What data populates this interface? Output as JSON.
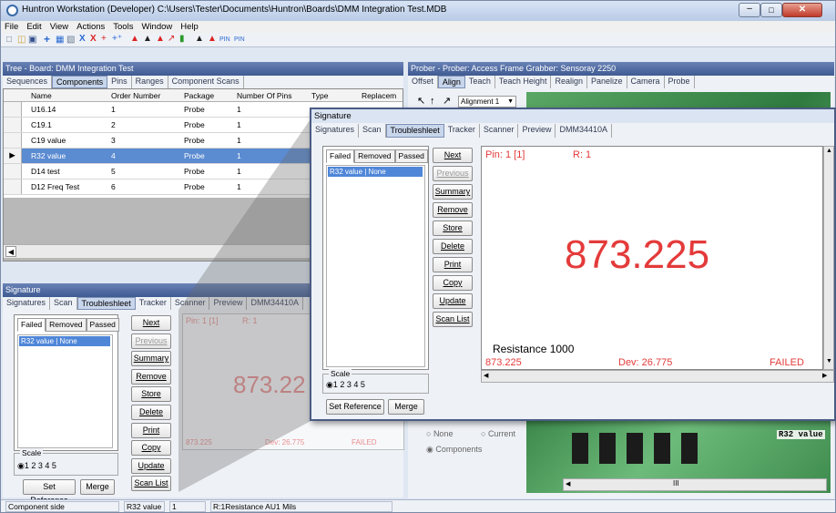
{
  "window": {
    "title": "Huntron Workstation (Developer) C:\\Users\\Tester\\Documents\\Huntron\\Boards\\DMM Integration Test.MDB",
    "menu": [
      "File",
      "Edit",
      "View",
      "Actions",
      "Tools",
      "Window",
      "Help"
    ]
  },
  "tree": {
    "title": "Tree - Board: DMM Integration Test",
    "tabs": [
      "Sequences",
      "Components",
      "Pins",
      "Ranges",
      "Component Scans"
    ],
    "active_tab": "Components",
    "columns": [
      "Name",
      "Order Number",
      "Package",
      "Number Of Pins",
      "Type",
      "Replacem"
    ],
    "rows": [
      {
        "name": "U16.14",
        "order": "1",
        "package": "Probe",
        "pins": "1"
      },
      {
        "name": "C19.1",
        "order": "2",
        "package": "Probe",
        "pins": "1"
      },
      {
        "name": "C19 value",
        "order": "3",
        "package": "Probe",
        "pins": "1"
      },
      {
        "name": "R32 value",
        "order": "4",
        "package": "Probe",
        "pins": "1"
      },
      {
        "name": "D14 test",
        "order": "5",
        "package": "Probe",
        "pins": "1"
      },
      {
        "name": "D12 Freq Test",
        "order": "6",
        "package": "Probe",
        "pins": "1"
      }
    ],
    "selected_row": 3
  },
  "prober": {
    "title": "Prober - Prober: Access Frame Grabber: Sensoray 2250",
    "tabs": [
      "Offset",
      "Align",
      "Teach",
      "Teach Height",
      "Realign",
      "Panelize",
      "Camera",
      "Probe"
    ],
    "active_tab": "Align",
    "alignment_value": "Alignment 1",
    "radio_none": "None",
    "radio_current": "Current",
    "radio_components": "Components",
    "board_label": "R32 value",
    "scroll_mark": "III"
  },
  "signature_small": {
    "title": "Signature",
    "tabs": [
      "Signatures",
      "Scan",
      "Troubleshleet",
      "Tracker",
      "Scanner",
      "Preview",
      "DMM34410A"
    ],
    "active_tab": "Troubleshleet",
    "list_tabs": [
      "Failed",
      "Removed",
      "Passed"
    ],
    "list_items": [
      "R32 value | None"
    ],
    "buttons": [
      "Next",
      "Previous",
      "Summary",
      "Remove",
      "Store",
      "Delete",
      "Print",
      "Copy",
      "Update",
      "Scan List"
    ],
    "scale_label": "Scale",
    "scale_options": "1  2  3  4  5",
    "set_reference": "Set Reference",
    "merge": "Merge",
    "pin_label": "Pin: 1 [1]",
    "r_label": "R: 1",
    "reading": "873.22",
    "footer_value": "873.225",
    "footer_dev": "Dev: 26.775",
    "footer_status": "FAILED"
  },
  "signature_large": {
    "title": "Signature",
    "tabs": [
      "Signatures",
      "Scan",
      "Troubleshleet",
      "Tracker",
      "Scanner",
      "Preview",
      "DMM34410A"
    ],
    "active_tab": "Troubleshleet",
    "list_tabs": [
      "Failed",
      "Removed",
      "Passed"
    ],
    "list_items": [
      "R32 value | None"
    ],
    "buttons": [
      "Next",
      "Previous",
      "Summary",
      "Remove",
      "Store",
      "Delete",
      "Print",
      "Copy",
      "Update",
      "Scan List"
    ],
    "scale_label": "Scale",
    "scale_options": "1  2  3  4  5",
    "set_reference": "Set Reference",
    "merge": "Merge",
    "pin_label": "Pin: 1 [1]",
    "r_label": "R: 1",
    "reading": "873.225",
    "resistance": "Resistance 1000",
    "footer_value": "873.225",
    "footer_dev": "Dev: 26.775",
    "footer_status": "FAILED"
  },
  "status_bar": {
    "fields": [
      "Component side",
      "R32 value",
      "1",
      "R:1Resistance  AU1 Mils"
    ]
  },
  "colors": {
    "reading_red": "#e43a3a",
    "title_blue": "#44619a",
    "selection_blue": "#5b8bd1"
  }
}
